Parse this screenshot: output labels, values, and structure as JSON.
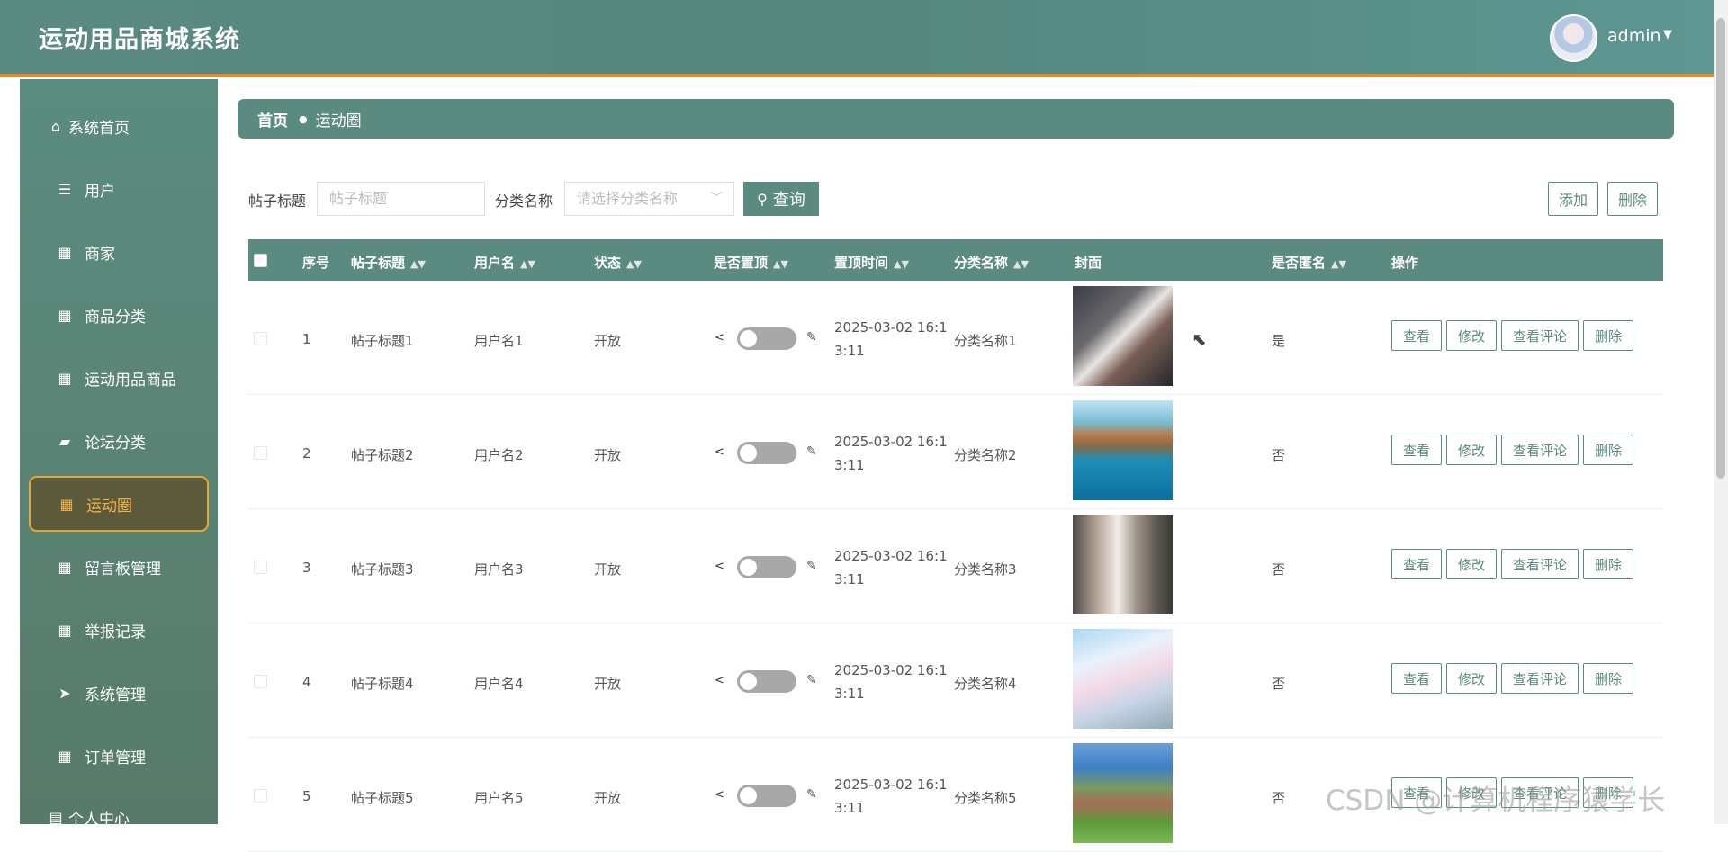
{
  "app": {
    "title": "运动用品商城系统",
    "user": "admin"
  },
  "sidebar": {
    "items": [
      {
        "label": "系统首页",
        "icon": "home-icon"
      },
      {
        "label": "用户",
        "icon": "sliders-icon"
      },
      {
        "label": "商家",
        "icon": "grid-icon"
      },
      {
        "label": "商品分类",
        "icon": "grid-icon"
      },
      {
        "label": "运动用品商品",
        "icon": "grid-icon"
      },
      {
        "label": "论坛分类",
        "icon": "briefcase-icon"
      },
      {
        "label": "运动圈",
        "icon": "grid-icon",
        "active": true
      },
      {
        "label": "留言板管理",
        "icon": "grid-icon"
      },
      {
        "label": "举报记录",
        "icon": "grid-icon"
      },
      {
        "label": "系统管理",
        "icon": "send-icon"
      },
      {
        "label": "订单管理",
        "icon": "grid-icon"
      },
      {
        "label": "个人中心",
        "icon": "document-icon"
      }
    ]
  },
  "breadcrumb": {
    "home": "首页",
    "current": "运动圈"
  },
  "search": {
    "title_label": "帖子标题",
    "title_placeholder": "帖子标题",
    "category_label": "分类名称",
    "category_placeholder": "请选择分类名称",
    "query_button": "查询",
    "add_button": "添加",
    "delete_button": "删除"
  },
  "table": {
    "columns": {
      "index": "序号",
      "title": "帖子标题",
      "username": "用户名",
      "status": "状态",
      "pinned": "是否置顶",
      "pin_time": "置顶时间",
      "category": "分类名称",
      "cover": "封面",
      "anonymous": "是否匿名",
      "actions": "操作"
    },
    "actions": {
      "view": "查看",
      "edit": "修改",
      "comments": "查看评论",
      "delete": "删除"
    },
    "rows": [
      {
        "index": "1",
        "title": "帖子标题1",
        "username": "用户名1",
        "status": "开放",
        "pin_time": "2025-03-02 16:13:11",
        "category": "分类名称1",
        "anonymous": "是"
      },
      {
        "index": "2",
        "title": "帖子标题2",
        "username": "用户名2",
        "status": "开放",
        "pin_time": "2025-03-02 16:13:11",
        "category": "分类名称2",
        "anonymous": "否"
      },
      {
        "index": "3",
        "title": "帖子标题3",
        "username": "用户名3",
        "status": "开放",
        "pin_time": "2025-03-02 16:13:11",
        "category": "分类名称3",
        "anonymous": "否"
      },
      {
        "index": "4",
        "title": "帖子标题4",
        "username": "用户名4",
        "status": "开放",
        "pin_time": "2025-03-02 16:13:11",
        "category": "分类名称4",
        "anonymous": "否"
      },
      {
        "index": "5",
        "title": "帖子标题5",
        "username": "用户名5",
        "status": "开放",
        "pin_time": "2025-03-02 16:13:11",
        "category": "分类名称5",
        "anonymous": "否"
      }
    ]
  },
  "watermark": "CSDN @计算机程序猿学长",
  "colors": {
    "primary": "#5a8a80",
    "accent": "#e8892a",
    "active_text": "#f0b34a",
    "active_bg": "#5d5a3c"
  }
}
